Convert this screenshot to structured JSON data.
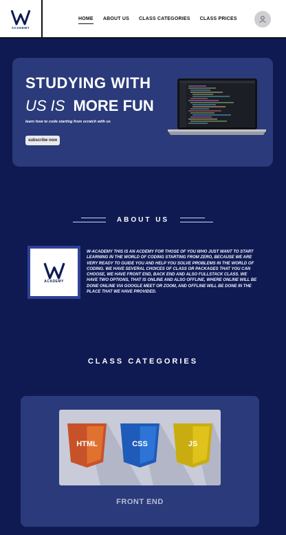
{
  "brand": {
    "logo_letter": "W",
    "logo_text": "ACADEMY"
  },
  "nav": {
    "items": [
      {
        "label": "HOME",
        "active": true
      },
      {
        "label": "ABOUT US",
        "active": false
      },
      {
        "label": "CLASS CATEGORIES",
        "active": false
      },
      {
        "label": "CLASS PRICES",
        "active": false
      }
    ]
  },
  "hero": {
    "title_line1": "STUDYING WITH",
    "title_line2_italic": "US IS",
    "title_line2_rest": "MORE FUN",
    "subtitle": "learn how to code starting from scratch with us",
    "button_label": "subscribe now"
  },
  "about": {
    "heading": "ABOUT US",
    "text": "W-ACADEMY  THIS IS AN ACDEMY FOR THOSE OF YOU WHO JUST WANT TO START LEARNING IN THE WORLD OF CODING STARTING FROM ZERO, BECAUSE WE ARE VERY READY TO GUIDE YOU AND HELP YOU SOLVE PROBLEMS IN THE WORLD OF CODING. WE HAVE SEVERAL CHOICES OF CLASS OR PACKAGES THAT YOU CAN CHOOSE, WE HAVE FRONT END, BACK END AND ALSO FULLSTACK CLASS. WE HAVE TWO OPTIONS, THAT IS ONLINE AND ALSO OFFLINE, WHERE ONLINE WILL BE DONE ONLINE VIA GOOGLE MEET OR ZOOM, AND OFFLINE WILL BE DONE IN THE PLACE THAT WE HAVE PROVIDED."
  },
  "categories": {
    "heading": "CLASS CATEGORIES",
    "cards": [
      {
        "label": "FRONT END",
        "badges": [
          "HTML",
          "CSS",
          "JS"
        ]
      }
    ]
  },
  "colors": {
    "background": "#0f1a52",
    "card": "#2a3a7a",
    "html_badge": "#c7522a",
    "css_badge": "#1f5bb8",
    "js_badge": "#c9ad10"
  }
}
